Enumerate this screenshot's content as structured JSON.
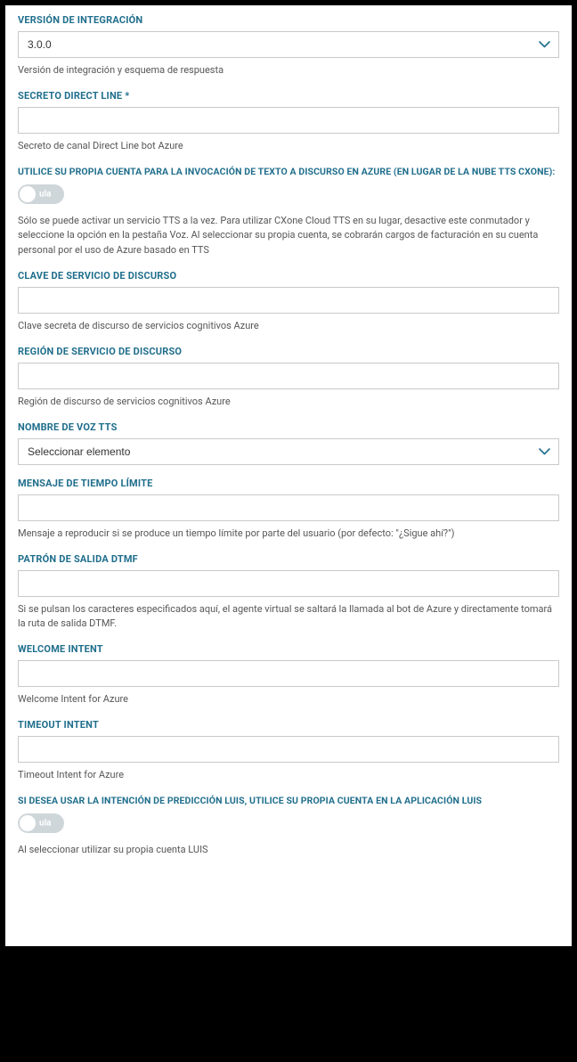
{
  "fields": {
    "integration_version": {
      "label": "VERSIÓN DE INTEGRACIÓN",
      "value": "3.0.0",
      "help": "Versión de integración y esquema de respuesta"
    },
    "direct_line_secret": {
      "label": "SECRETO DIRECT LINE *",
      "value": "",
      "help": "Secreto de canal Direct Line bot Azure"
    },
    "own_account_tts": {
      "label": "UTILICE SU PROPIA CUENTA PARA LA INVOCACIÓN DE TEXTO A DISCURSO EN AZURE (EN LUGAR DE LA NUBE TTS CXONE):",
      "toggle_text": "ula",
      "help": "Sólo se puede activar un servicio TTS a la vez. Para utilizar CXone Cloud TTS en su lugar, desactive este conmutador y seleccione la opción en la pestaña Voz. Al seleccionar su propia cuenta, se cobrarán cargos de facturación en su cuenta personal por el uso de Azure basado en TTS"
    },
    "speech_service_key": {
      "label": "CLAVE DE SERVICIO DE DISCURSO",
      "value": "",
      "help": "Clave secreta de discurso de servicios cognitivos Azure"
    },
    "speech_service_region": {
      "label": "REGIÓN DE SERVICIO DE DISCURSO",
      "value": "",
      "help": "Región de discurso de servicios cognitivos Azure"
    },
    "tts_voice_name": {
      "label": "NOMBRE DE VOZ TTS",
      "value": "Seleccionar elemento"
    },
    "timeout_message": {
      "label": "MENSAJE DE TIEMPO LÍMITE",
      "value": "",
      "help": "Mensaje a reproducir si se produce un tiempo límite por parte del usuario (por defecto: \"¿Sigue ahí?\")"
    },
    "dtmf_pattern": {
      "label": "PATRÓN DE SALIDA DTMF",
      "value": "",
      "help": "Si se pulsan los caracteres especificados aquí, el agente virtual se saltará la llamada al bot de Azure y directamente tomará la ruta de salida DTMF."
    },
    "welcome_intent": {
      "label": "WELCOME INTENT",
      "value": "",
      "help": "Welcome Intent for Azure"
    },
    "timeout_intent": {
      "label": "TIMEOUT INTENT",
      "value": "",
      "help": "Timeout Intent for Azure"
    },
    "luis_own_account": {
      "label": "SI DESEA USAR LA INTENCIÓN DE PREDICCIÓN LUIS, UTILICE SU PROPIA CUENTA EN LA APLICACIÓN LUIS",
      "toggle_text": "ula",
      "help": "Al seleccionar utilizar su propia cuenta LUIS"
    }
  }
}
